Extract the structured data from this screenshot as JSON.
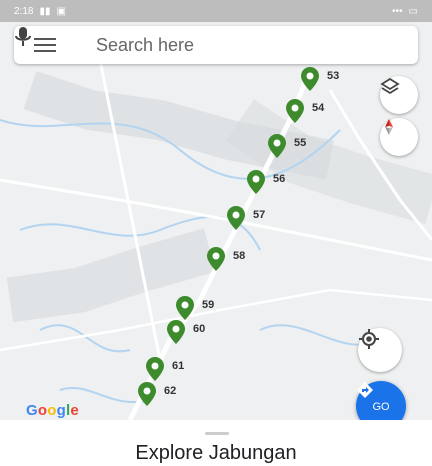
{
  "status_bar": {
    "time": "2:18",
    "indicators": "•••"
  },
  "search": {
    "placeholder": "Search here"
  },
  "map": {
    "brand": [
      "G",
      "o",
      "o",
      "g",
      "l",
      "e"
    ],
    "brand_colors": [
      "#4285F4",
      "#EA4335",
      "#FBBC05",
      "#4285F4",
      "#34A853",
      "#EA4335"
    ],
    "pin_color": "#3d8b2c",
    "markers": [
      {
        "label": "53"
      },
      {
        "label": "54"
      },
      {
        "label": "55"
      },
      {
        "label": "56"
      },
      {
        "label": "57"
      },
      {
        "label": "58"
      },
      {
        "label": "59"
      },
      {
        "label": "60"
      },
      {
        "label": "61"
      },
      {
        "label": "62"
      }
    ]
  },
  "controls": {
    "layers_icon": "layers-icon",
    "compass_icon": "compass-icon",
    "locate_icon": "my-location-icon",
    "go_label": "GO",
    "go_color": "#1a73e8"
  },
  "sheet": {
    "title": "Explore Jabungan"
  }
}
